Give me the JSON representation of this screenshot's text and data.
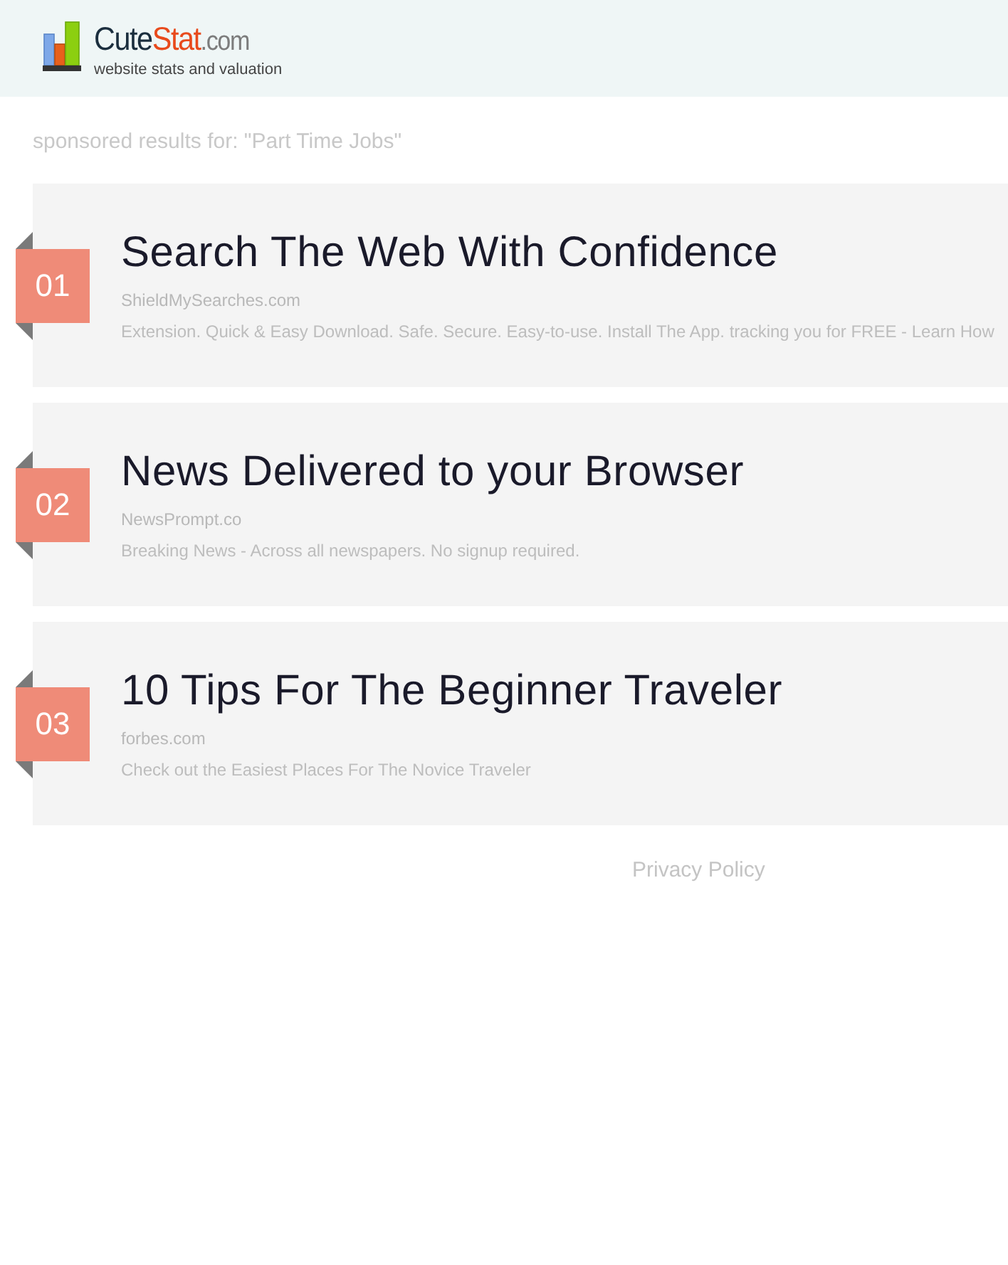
{
  "header": {
    "logo": {
      "name_main": "Cute",
      "name_accent": "Stat",
      "suffix": ".com",
      "tagline": "website stats and valuation"
    }
  },
  "heading": "sponsored results for: \"Part Time Jobs\"",
  "results": [
    {
      "rank": "01",
      "title": "Search The Web With Confidence",
      "domain": "ShieldMySearches.com",
      "description": "Extension. Quick & Easy Download. Safe. Secure. Easy-to-use. Install The App. tracking you for FREE - Learn How"
    },
    {
      "rank": "02",
      "title": "News Delivered to your Browser",
      "domain": "NewsPrompt.co",
      "description": "Breaking News - Across all newspapers. No signup required."
    },
    {
      "rank": "03",
      "title": "10 Tips For The Beginner Traveler",
      "domain": "forbes.com",
      "description": "Check out the Easiest Places For The Novice Traveler"
    }
  ],
  "footer": {
    "link": "Privacy Policy"
  }
}
